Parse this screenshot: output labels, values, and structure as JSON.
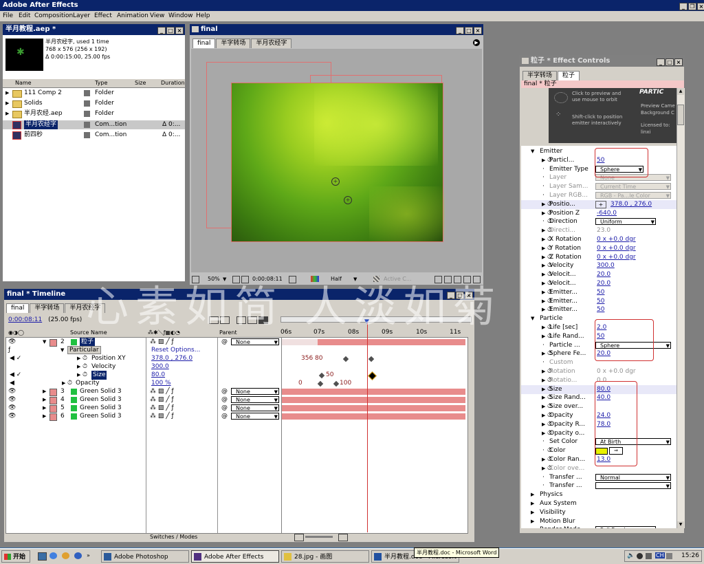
{
  "app": {
    "title": "Adobe After Effects",
    "menu": [
      "File",
      "Edit",
      "Composition",
      "Layer",
      "Effect",
      "Animation",
      "View",
      "Window",
      "Help"
    ]
  },
  "project": {
    "title": "半月教程.aep *",
    "selected_name": "半月农经字",
    "selected_used": ", used 1 time",
    "selected_size": "768 x 576  (256 x 192)",
    "selected_duration": "Δ 0:00:15:00, 25.00 fps",
    "columns": [
      "Name",
      "Type",
      "Size",
      "Duration"
    ],
    "items": [
      {
        "name": "111 Comp 2",
        "type": "Folder",
        "duration": ""
      },
      {
        "name": "Solids",
        "type": "Folder",
        "duration": ""
      },
      {
        "name": "半月农经.aep",
        "type": "Folder",
        "duration": ""
      },
      {
        "name": "半月农经字",
        "type": "Com...tion",
        "duration": "Δ 0:..."
      },
      {
        "name": "前四秒",
        "type": "Com...tion",
        "duration": "Δ 0:..."
      }
    ]
  },
  "comp": {
    "title": "final",
    "tabs": [
      "final",
      "半字转场",
      "半月农经字"
    ],
    "zoom": "50%",
    "time": "0:00:08:11",
    "resolution": "Half",
    "camera": "Active C..."
  },
  "timeline": {
    "title": "final * Timeline",
    "tabs": [
      "final",
      "半字转场",
      "半月农经字"
    ],
    "current_time": "0:00:08:11",
    "fps": "(25.00 fps)",
    "col_source": "Source Name",
    "col_parent": "Parent",
    "ruler": [
      "06s",
      "07s",
      "08s",
      "09s",
      "10s",
      "11s"
    ],
    "switches_label": "Switches / Modes",
    "layers": [
      {
        "num": "2",
        "name": "粒子",
        "parent": "None"
      },
      {
        "num": "3",
        "name": "Green Solid 3",
        "parent": "None"
      },
      {
        "num": "4",
        "name": "Green Solid 3",
        "parent": "None"
      },
      {
        "num": "5",
        "name": "Green Solid 3",
        "parent": "None"
      },
      {
        "num": "6",
        "name": "Green Solid 3",
        "parent": "None"
      }
    ],
    "effect_name": "Particular",
    "reset": "Reset Options...",
    "props": [
      {
        "name": "Position XY",
        "value": "378.0 , 276.0"
      },
      {
        "name": "Velocity",
        "value": "300.0"
      },
      {
        "name": "Size",
        "value": "80.0"
      },
      {
        "name": "Opacity",
        "value": "100 %"
      }
    ],
    "kf_labels": {
      "pos": "356 80",
      "size": "50",
      "op0": "0",
      "op100": "100"
    }
  },
  "effect_controls": {
    "title": "粒子 * Effect Controls",
    "tabs": [
      "半字转场",
      "粒子"
    ],
    "layer_label": "final * 粒子",
    "preview_text1": "Click to preview and use mouse to orbit",
    "preview_text2": "Shift-click to position emitter interactively",
    "brand": "PARTIC",
    "preview_cam": "Preview Came",
    "bg_color": "Background C",
    "licensed": "Licensed to:",
    "user": "linxi",
    "emitter_group": "Emitter",
    "emitter": [
      {
        "name": "Particl...",
        "value": "50"
      },
      {
        "name": "Emitter Type",
        "value": "Sphere"
      },
      {
        "name": "Layer",
        "value": "None"
      },
      {
        "name": "Layer Sam...",
        "value": "Current Time"
      },
      {
        "name": "Layer RGB...",
        "value": "RGB - Pa...le Color"
      },
      {
        "name": "Positio...",
        "value": "378.0 , 276.0"
      },
      {
        "name": "Position Z",
        "value": "-640.0"
      },
      {
        "name": "Direction",
        "value": "Uniform"
      },
      {
        "name": "Directi...",
        "value": "23.0"
      },
      {
        "name": "X Rotation",
        "value": "0 x +0.0 dgr"
      },
      {
        "name": "Y Rotation",
        "value": "0 x +0.0 dgr"
      },
      {
        "name": "Z Rotation",
        "value": "0 x +0.0 dgr"
      },
      {
        "name": "Velocity",
        "value": "300.0"
      },
      {
        "name": "Velocit...",
        "value": "20.0"
      },
      {
        "name": "Velocit...",
        "value": "20.0"
      },
      {
        "name": "Emitter...",
        "value": "50"
      },
      {
        "name": "Emitter...",
        "value": "50"
      },
      {
        "name": "Emitter...",
        "value": "50"
      }
    ],
    "particle_group": "Particle",
    "particle": [
      {
        "name": "Life [sec]",
        "value": "2.0"
      },
      {
        "name": "Life Rand...",
        "value": "50"
      },
      {
        "name": "Particle ...",
        "value": "Sphere"
      },
      {
        "name": "Sphere Fe...",
        "value": "20.0"
      },
      {
        "name": "Custom",
        "value": ""
      },
      {
        "name": "Rotation",
        "value": "0 x +0.0 dgr"
      },
      {
        "name": "Rotatio...",
        "value": "0.0"
      },
      {
        "name": "Size",
        "value": "80.0"
      },
      {
        "name": "Size Rand...",
        "value": "40.0"
      },
      {
        "name": "Size over...",
        "value": ""
      },
      {
        "name": "Opacity",
        "value": "24.0"
      },
      {
        "name": "Opacity R...",
        "value": "78.0"
      },
      {
        "name": "Opacity o...",
        "value": ""
      },
      {
        "name": "Set Color",
        "value": "At Birth"
      },
      {
        "name": "Color",
        "value": ""
      },
      {
        "name": "Color Ran...",
        "value": "13.0"
      },
      {
        "name": "Color ove...",
        "value": ""
      },
      {
        "name": "Transfer ...",
        "value": "Normal"
      },
      {
        "name": "Transfer ...",
        "value": ""
      }
    ],
    "groups": [
      "Physics",
      "Aux System",
      "Visibility",
      "Motion Blur"
    ],
    "render_mode_label": "Render Mode",
    "render_mode": "Full Render",
    "color_swatch": "#e8f000"
  },
  "watermark": "心素如简 人淡如菊",
  "taskbar": {
    "start": "开始",
    "items": [
      "Adobe Photoshop",
      "Adobe After Effects",
      "28.jpg - 画图",
      "半月教程.doc - Microsoft Word"
    ],
    "tooltip": "半月教程.doc - Microsoft Word",
    "ime": "CH",
    "clock": "15:26"
  },
  "colors": {
    "desktop": "#3a6ea5",
    "titlebar": "#0a246a",
    "chrome": "#d4d0c8",
    "bar": "#e88c8c"
  }
}
